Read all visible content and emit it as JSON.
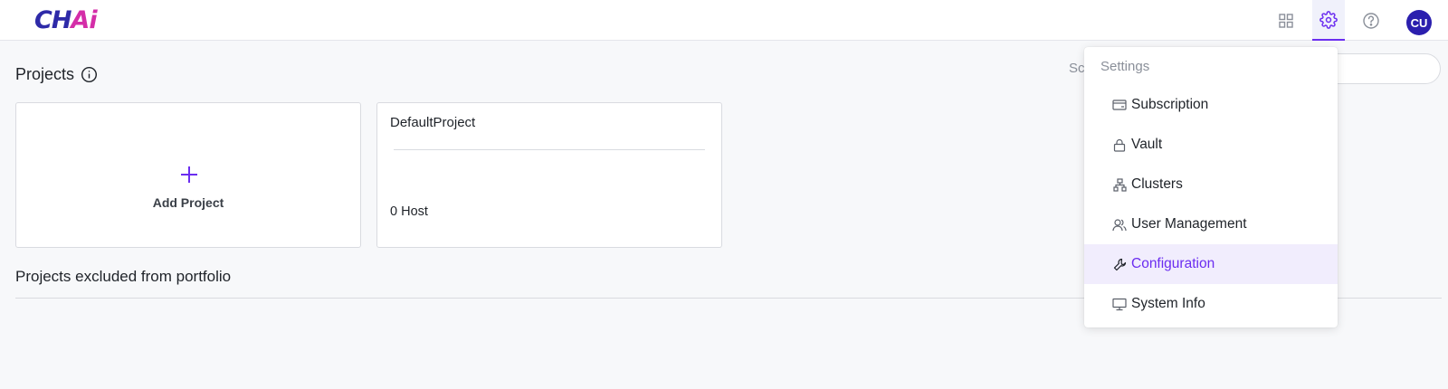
{
  "app": {
    "logo_part1": "CH",
    "logo_part2": "Ai"
  },
  "header": {
    "icons": [
      "grid-icon",
      "gear-icon",
      "help-icon"
    ],
    "active_icon": "gear-icon",
    "avatar_initials": "CU"
  },
  "page": {
    "title": "Projects",
    "search_label": "Sc"
  },
  "cards": {
    "add_label": "Add Project",
    "project": {
      "name": "DefaultProject",
      "hosts": "0 Host"
    }
  },
  "excluded": {
    "title": "Projects excluded from portfolio"
  },
  "settings_menu": {
    "header": "Settings",
    "items": [
      {
        "label": "Subscription",
        "icon": "card-icon"
      },
      {
        "label": "Vault",
        "icon": "lock-icon"
      },
      {
        "label": "Clusters",
        "icon": "cluster-icon"
      },
      {
        "label": "User Management",
        "icon": "users-icon"
      },
      {
        "label": "Configuration",
        "icon": "wrench-icon",
        "selected": true
      },
      {
        "label": "System Info",
        "icon": "monitor-icon"
      }
    ]
  },
  "colors": {
    "accent": "#6b2df0",
    "avatar_bg": "#2b1fae",
    "selected_bg": "#f1edfd"
  }
}
